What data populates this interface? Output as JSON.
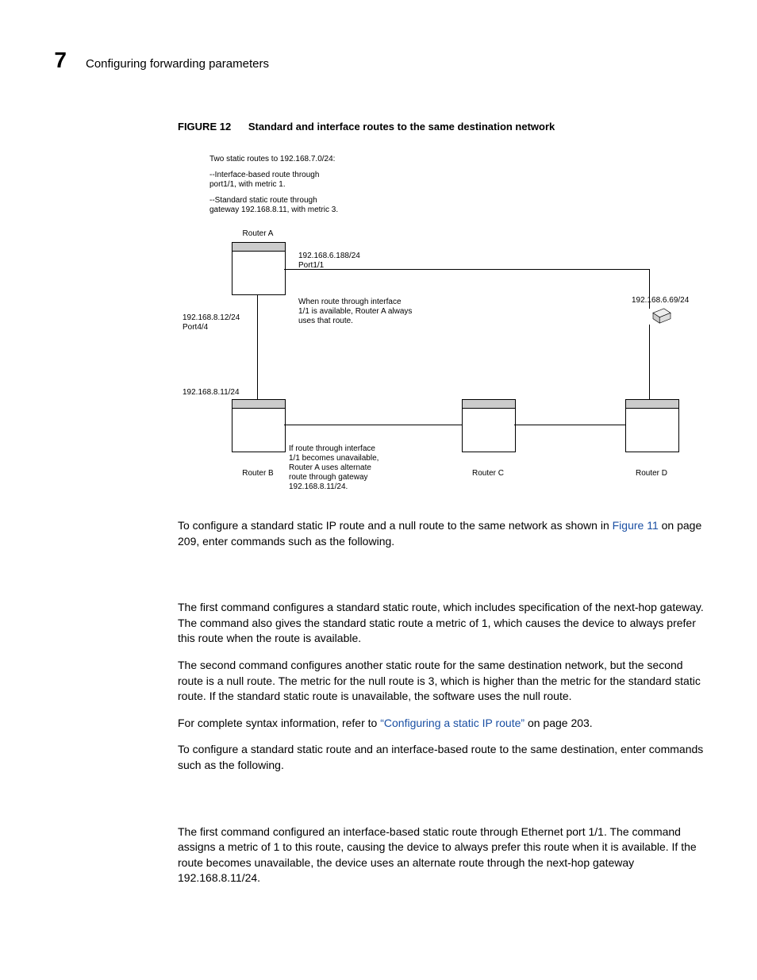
{
  "header": {
    "chapter_num": "7",
    "chapter_title": "Configuring forwarding parameters"
  },
  "figure": {
    "label": "FIGURE 12",
    "caption": "Standard and interface routes to the same destination network",
    "intro_line": "Two static routes to 192.168.7.0/24:",
    "desc1_line1": "--Interface-based route through",
    "desc1_line2": "port1/1, with metric 1.",
    "desc2_line1": "--Standard static route through",
    "desc2_line2": "gateway 192.168.8.11, with metric 3.",
    "routerA_label": "Router A",
    "routerB_label": "Router B",
    "routerC_label": "Router C",
    "routerD_label": "Router D",
    "portA_top_l1": "192.168.6.188/24",
    "portA_top_l2": "Port1/1",
    "portA_left_l1": "192.168.8.12/24",
    "portA_left_l2": "Port4/4",
    "note_available_l1": "When route through interface",
    "note_available_l2": "1/1 is available, Router A always",
    "note_available_l3": "uses that route.",
    "routerB_top": "192.168.8.11/24",
    "note_unavail_l1": "If route through interface",
    "note_unavail_l2": "1/1 becomes unavailable,",
    "note_unavail_l3": "Router A uses alternate",
    "note_unavail_l4": "route through gateway",
    "note_unavail_l5": "192.168.8.11/24.",
    "host_label": "192.168.6.69/24"
  },
  "body": {
    "p1_a": "To configure a standard static IP route and a null route to the same network as shown in ",
    "p1_link": "Figure 11",
    "p1_b": " on page 209, enter commands such as the following.",
    "p2": "The first command configures a standard static route, which includes specification of the next-hop gateway. The command also gives the standard static route a metric of 1, which causes the device to always prefer this route when the route is available.",
    "p3": "The second command configures another static route for the same destination network, but the second route is a null route.  The metric for the null route is 3, which is higher than the metric for the standard static route.  If the standard static route is unavailable, the software uses the null route.",
    "p4_a": "For complete syntax information, refer to ",
    "p4_link": "“Configuring a static IP route”",
    "p4_b": " on page 203.",
    "p5": "To configure a standard static route and an interface-based route to the same destination, enter commands such as the following.",
    "p6": "The first command configured an interface-based static route through Ethernet port 1/1. The command assigns a metric of 1 to this route, causing the device to always prefer this route when it is available. If the route becomes unavailable, the device uses an alternate route through the next-hop gateway 192.168.8.11/24."
  }
}
